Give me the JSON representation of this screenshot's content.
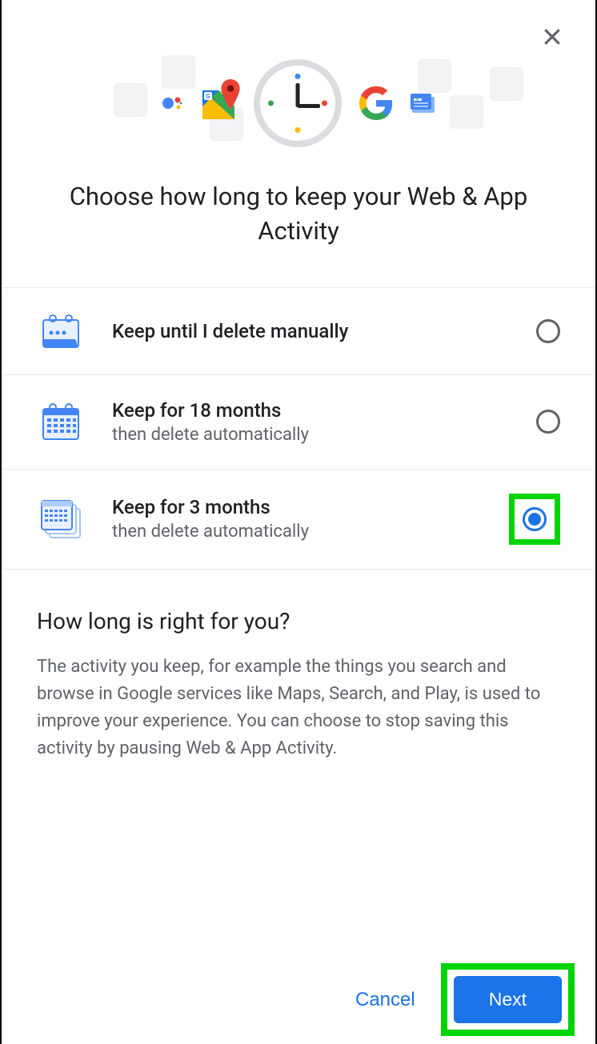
{
  "header": {
    "close_aria": "Close"
  },
  "title": "Choose how long to keep your Web & App Activity",
  "options": [
    {
      "id": "manual",
      "title": "Keep until I delete manually",
      "subtitle": "",
      "selected": false
    },
    {
      "id": "18mo",
      "title": "Keep for 18 months",
      "subtitle": "then delete automatically",
      "selected": false
    },
    {
      "id": "3mo",
      "title": "Keep for 3 months",
      "subtitle": "then delete automatically",
      "selected": true
    }
  ],
  "info": {
    "heading": "How long is right for you?",
    "body": "The activity you keep, for example the things you search and browse in Google services like Maps, Search, and Play, is used to improve your experience. You can choose to stop saving this activity by pausing Web & App Activity."
  },
  "footer": {
    "cancel": "Cancel",
    "next": "Next"
  },
  "hero_icons": [
    "tag",
    "assistant",
    "maps",
    "clock",
    "google-g",
    "news",
    "lens"
  ]
}
